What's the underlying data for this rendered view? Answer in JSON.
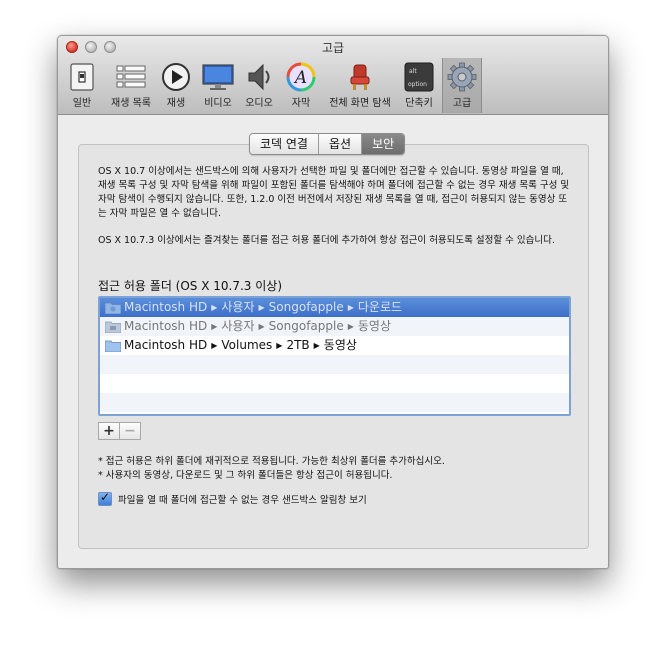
{
  "window": {
    "title": "고급"
  },
  "toolbar": {
    "items": [
      {
        "label": "일반",
        "icon": "general-switch-icon"
      },
      {
        "label": "재생 목록",
        "icon": "playlist-icon"
      },
      {
        "label": "재생",
        "icon": "play-icon"
      },
      {
        "label": "비디오",
        "icon": "monitor-icon"
      },
      {
        "label": "오디오",
        "icon": "speaker-icon"
      },
      {
        "label": "자막",
        "icon": "subtitle-icon"
      },
      {
        "label": "전체 화면 탐색",
        "icon": "theater-seat-icon"
      },
      {
        "label": "단축키",
        "icon": "keyboard-key-icon"
      },
      {
        "label": "고급",
        "icon": "gear-icon"
      }
    ],
    "selected": "고급",
    "key_labels": {
      "top": "alt",
      "bottom": "option"
    }
  },
  "tabs": [
    {
      "label": "코덱 연결",
      "active": false
    },
    {
      "label": "옵션",
      "active": false
    },
    {
      "label": "보안",
      "active": true
    }
  ],
  "security": {
    "para1": "OS X 10.7 이상에서는 샌드박스에 의해 사용자가 선택한 파일 및 폴더에만 접근할 수 있습니다. 동영상 파일을 열 때, 재생 목록 구성 및 자막 탐색을 위해 파일이 포함된 폴더를 탐색해야 하며 폴더에 접근할 수 없는 경우 재생 목록 구성 및 자막 탐색이 수행되지 않습니다. 또한, 1.2.0 이전 버전에서 저장된 재생 목록을 열 때, 접근이 허용되지 않는 동영상 또는 자막 파일은 열 수 없습니다.",
    "para2": "OS X 10.7.3 이상에서는 즐겨찾는 폴더를 접근 허용 폴더에 추가하여 항상 접근이 허용되도록 설정할 수 있습니다.",
    "list_title": "접근 허용 폴더 (OS X 10.7.3 이상)",
    "folders": [
      {
        "path": [
          "Macintosh HD",
          "사용자",
          "Songofapple",
          "다운로드"
        ],
        "state": "selected"
      },
      {
        "path": [
          "Macintosh HD",
          "사용자",
          "Songofapple",
          "동영상"
        ],
        "state": "dimmed"
      },
      {
        "path": [
          "Macintosh HD",
          "Volumes",
          "2TB",
          "동영상"
        ],
        "state": "normal"
      }
    ],
    "path_separator": "▶",
    "add_label": "+",
    "remove_label": "−",
    "note1": "* 접근 허용은 하위 폴더에 재귀적으로 적용됩니다. 가능한 최상위 폴더를 추가하십시오.",
    "note2": "* 사용자의 동영상, 다운로드 및 그 하위 폴더들은 항상 접근이 허용됩니다.",
    "checkbox_label": "파일을 열 때 폴더에 접근할 수 없는 경우 샌드박스 알림창 보기",
    "checkbox_checked": true
  },
  "colors": {
    "selection": "#3c6fc9",
    "focus_ring": "#7da2d8",
    "close": "#d8392b"
  }
}
